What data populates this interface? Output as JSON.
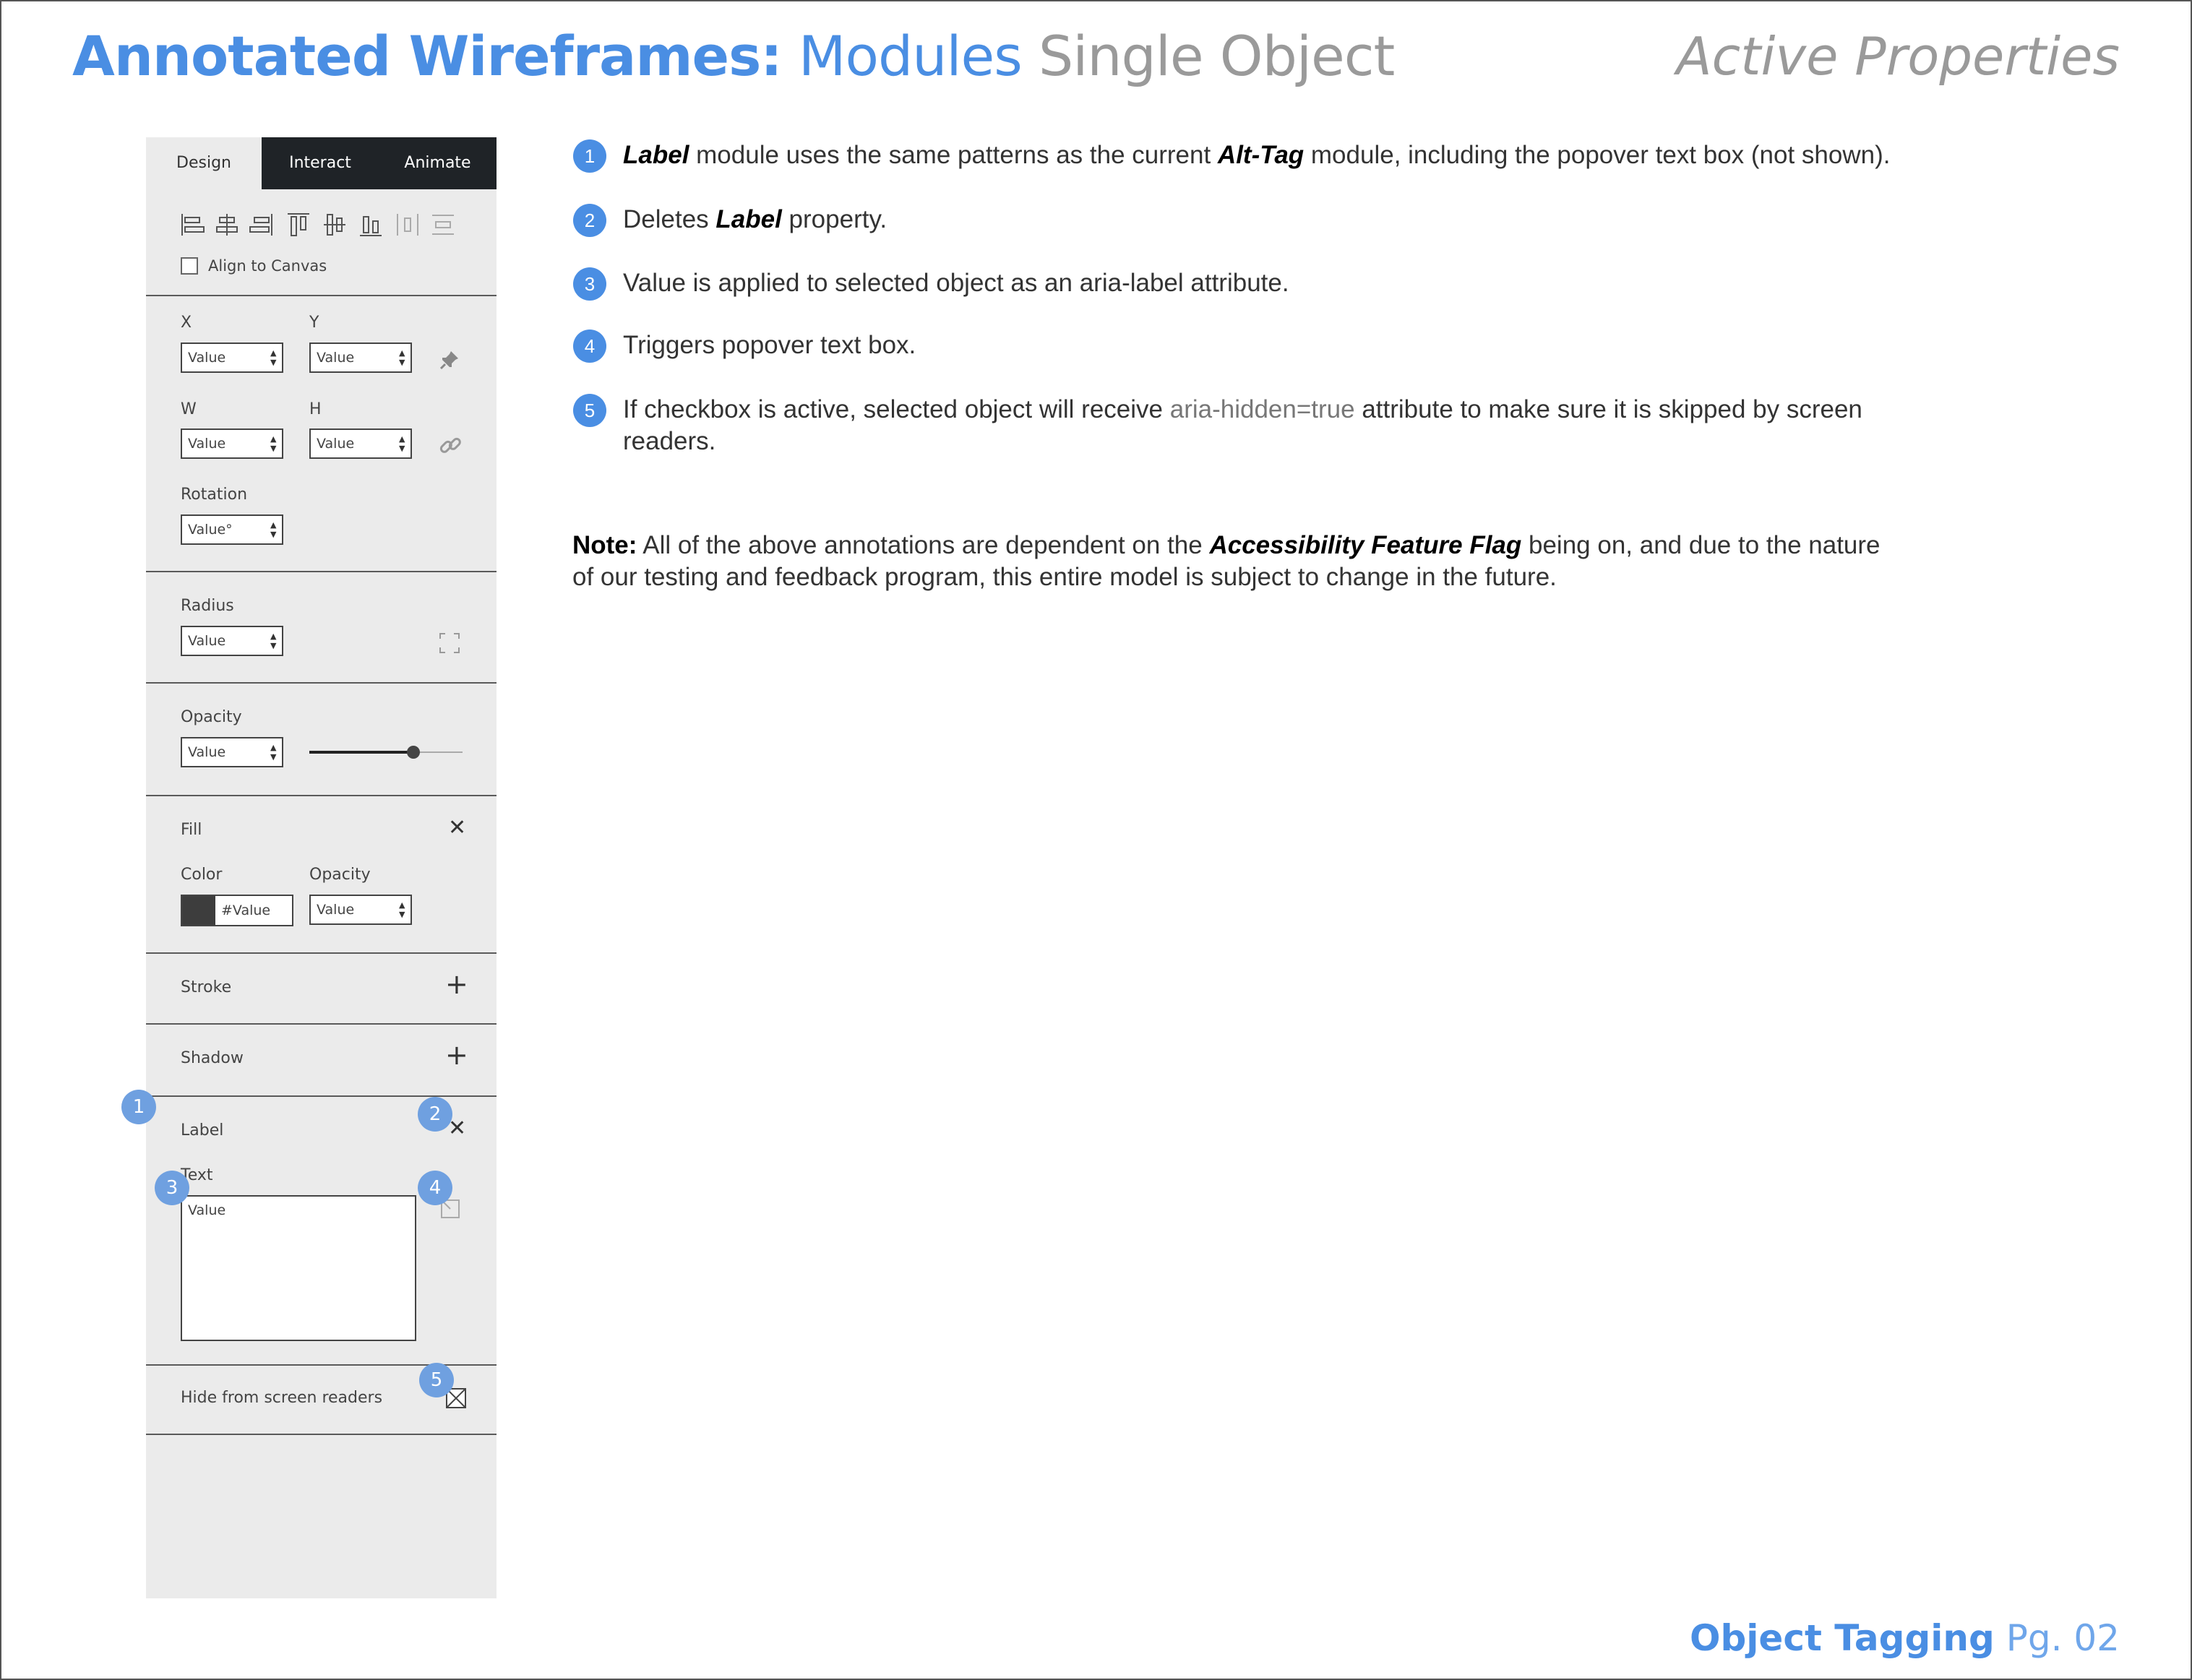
{
  "header": {
    "title_bold": "Annotated Wireframes:",
    "title_modules": "Modules",
    "title_rest": "Single Object",
    "right": "Active Properties"
  },
  "footer": {
    "bold": "Object Tagging",
    "page": "Pg. 02"
  },
  "panel": {
    "tabs": [
      "Design",
      "Interact",
      "Animate"
    ],
    "align_to_canvas": "Align to Canvas",
    "x_label": "X",
    "y_label": "Y",
    "w_label": "W",
    "h_label": "H",
    "rotation_label": "Rotation",
    "radius_label": "Radius",
    "opacity_label": "Opacity",
    "fill_label": "Fill",
    "color_label": "Color",
    "fill_opacity_label": "Opacity",
    "stroke_label": "Stroke",
    "shadow_label": "Shadow",
    "label_label": "Label",
    "text_label": "Text",
    "hide_label": "Hide from screen readers",
    "value": "Value",
    "value_deg": "Value°",
    "hex_value": "#Value",
    "opacity_slider": 0.68,
    "fill_color": "#3d3d3d"
  },
  "badges": [
    "1",
    "2",
    "3",
    "4",
    "5"
  ],
  "notes": [
    {
      "num": "1",
      "pre": "",
      "b1": "Label",
      "mid": " module uses the same patterns as the current ",
      "b2": "Alt-Tag",
      "post": " module, including the popover text box (not shown)."
    },
    {
      "num": "2",
      "pre": "Deletes ",
      "b1": "Label",
      "post": " property."
    },
    {
      "num": "3",
      "text": "Value is applied to selected object as an aria-label attribute."
    },
    {
      "num": "4",
      "text": "Triggers popover text box."
    },
    {
      "num": "5",
      "pre": "If checkbox is active, selected object will receive ",
      "code": "aria-hidden=true",
      "post": " attribute to make sure it is skipped by screen readers."
    }
  ],
  "note_block": {
    "label": "Note:",
    "pre": " All of the above annotations are dependent on the ",
    "flag": "Accessibility Feature Flag",
    "post": " being on, and due to the nature of our testing and feedback program, this entire model is subject to change in the future."
  }
}
